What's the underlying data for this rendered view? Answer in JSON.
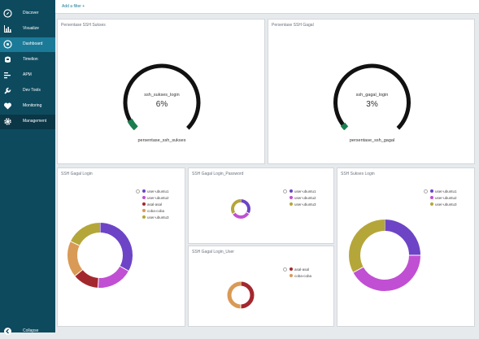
{
  "sidebar": {
    "items": [
      {
        "label": "Discover",
        "icon": "compass-icon"
      },
      {
        "label": "Visualize",
        "icon": "bar-chart-icon"
      },
      {
        "label": "Dashboard",
        "icon": "dashboard-icon",
        "active": true
      },
      {
        "label": "Timelion",
        "icon": "timelion-icon"
      },
      {
        "label": "APM",
        "icon": "apm-icon"
      },
      {
        "label": "Dev Tools",
        "icon": "wrench-icon"
      },
      {
        "label": "Monitoring",
        "icon": "heartbeat-icon"
      },
      {
        "label": "Management",
        "icon": "gear-icon"
      }
    ],
    "collapse_label": "Collapse"
  },
  "topbar": {
    "filter_link": "Add a filter +"
  },
  "colors": {
    "sidebar_bg": "#0d4a5e",
    "active_item": "#1b7a98",
    "gauge_arc": "#111111",
    "gauge_fill": "#1a7f4e",
    "purple": "#6d44c6",
    "magenta": "#c14fd3",
    "dark_red": "#a3282e",
    "orange": "#d99a56",
    "olive": "#b5a63a"
  },
  "gauges": [
    {
      "title": "Persentase SSH Sukses",
      "metric": "ssh_sukses_login",
      "value": "6%",
      "percent": 6,
      "subtitle": "persentase_ssh_sukses"
    },
    {
      "title": "Persentase SSH Gagal",
      "metric": "ssh_gagal_login",
      "value": "3%",
      "percent": 3,
      "subtitle": "persentase_ssh_gagal"
    }
  ],
  "donuts": [
    {
      "title": "SSH Gagal Login",
      "legend": [
        "user-ubuntu1",
        "user-ubuntu2",
        "asal-asal",
        "coba-coba",
        "user-ubuntu3"
      ],
      "chart_data": {
        "type": "pie",
        "labels": [
          "user-ubuntu1",
          "user-ubuntu2",
          "asal-asal",
          "coba-coba",
          "user-ubuntu3"
        ],
        "values": [
          33,
          18,
          13,
          18,
          18
        ],
        "colors": [
          "#6d44c6",
          "#c14fd3",
          "#a3282e",
          "#d99a56",
          "#b5a63a"
        ]
      }
    },
    {
      "title": "SSH Gagal Login_Password",
      "legend": [
        "user-ubuntu1",
        "user-ubuntu2",
        "user-ubuntu3"
      ],
      "chart_data": {
        "type": "pie",
        "labels": [
          "user-ubuntu1",
          "user-ubuntu2",
          "user-ubuntu3"
        ],
        "values": [
          33,
          33,
          34
        ],
        "colors": [
          "#6d44c6",
          "#c14fd3",
          "#b5a63a"
        ]
      }
    },
    {
      "title": "SSH Gagal Login_User",
      "legend": [
        "asal-asal",
        "coba-coba"
      ],
      "chart_data": {
        "type": "pie",
        "labels": [
          "asal-asal",
          "coba-coba"
        ],
        "values": [
          50,
          50
        ],
        "colors": [
          "#a3282e",
          "#d99a56"
        ]
      }
    },
    {
      "title": "SSH Sukses Login",
      "legend": [
        "user-ubuntu1",
        "user-ubuntu2",
        "user-ubuntu3"
      ],
      "chart_data": {
        "type": "pie",
        "labels": [
          "user-ubuntu1",
          "user-ubuntu2",
          "user-ubuntu3"
        ],
        "values": [
          25,
          42,
          33
        ],
        "colors": [
          "#6d44c6",
          "#c14fd3",
          "#b5a63a"
        ]
      }
    }
  ]
}
